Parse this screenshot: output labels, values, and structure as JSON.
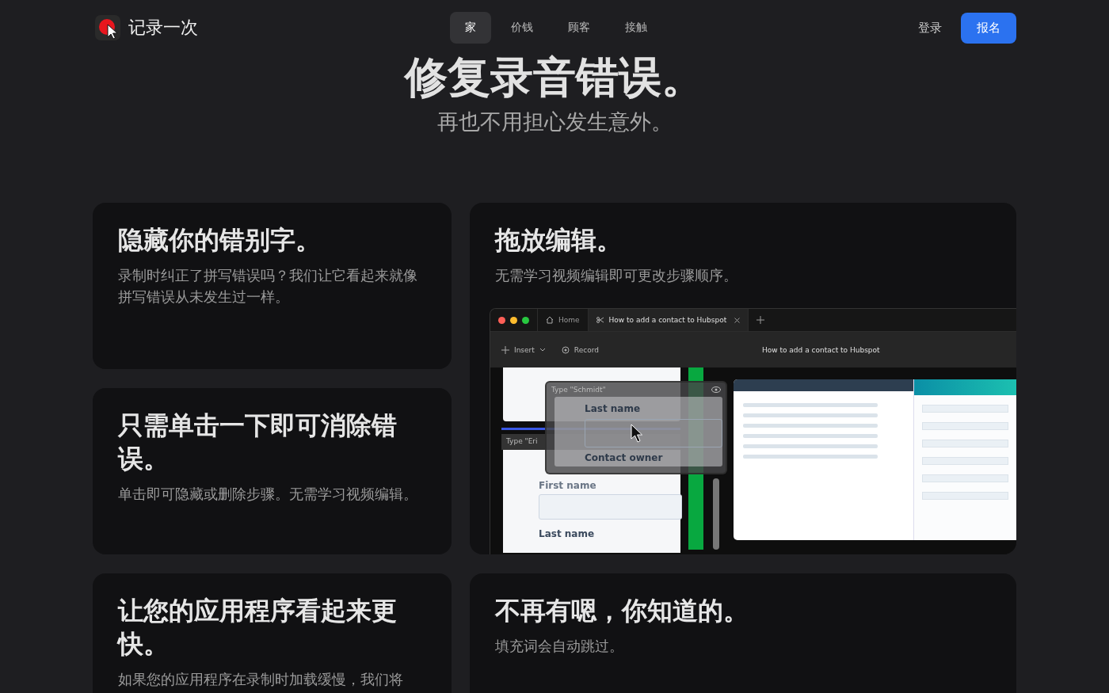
{
  "header": {
    "logo_text": "记录一次",
    "nav": [
      {
        "label": "家",
        "selected": true
      },
      {
        "label": "价钱",
        "selected": false
      },
      {
        "label": "顾客",
        "selected": false
      },
      {
        "label": "接触",
        "selected": false
      }
    ],
    "login": "登录",
    "signup": "报名"
  },
  "hero": {
    "title": "修复录音错误。",
    "subtitle": "再也不用担心发生意外。"
  },
  "features": [
    {
      "kind": "text",
      "title": "隐藏你的错别字。",
      "description": "录制时纠正了拼写错误吗？我们让它看起来就像拼写错误从未发生过一样。"
    },
    {
      "kind": "demo",
      "title": "拖放编辑。",
      "description": "无需学习视频编辑即可更改步骤顺序。"
    },
    {
      "kind": "text",
      "title": "只需单击一下即可消除错误。",
      "description": "单击即可隐藏或删除步骤。无需学习视频编辑。"
    },
    {
      "kind": "text",
      "title": "让您的应用程序看起来更快。",
      "description": "如果您的应用程序在录制时加载缓慢，我们将"
    },
    {
      "kind": "text",
      "title": "不再有嗯，你知道的。",
      "description": "填充词会自动跳过。"
    }
  ],
  "demo": {
    "tabs": [
      {
        "label": "Home",
        "kind": "home",
        "selected": false
      },
      {
        "label": "How to add a contact to Hubspot",
        "kind": "guide",
        "selected": true
      }
    ],
    "insert": "Insert",
    "record": "Record",
    "doc_title": "How to add a contact to Hubspot",
    "form_labels": [
      "Last name"
    ],
    "step_behind": {
      "label": "Type \"Eri",
      "field_label": "First name"
    },
    "step_dragged": {
      "label": "Type \"Schmidt\"",
      "field_labels": [
        "Last name",
        "Contact owner"
      ]
    }
  }
}
